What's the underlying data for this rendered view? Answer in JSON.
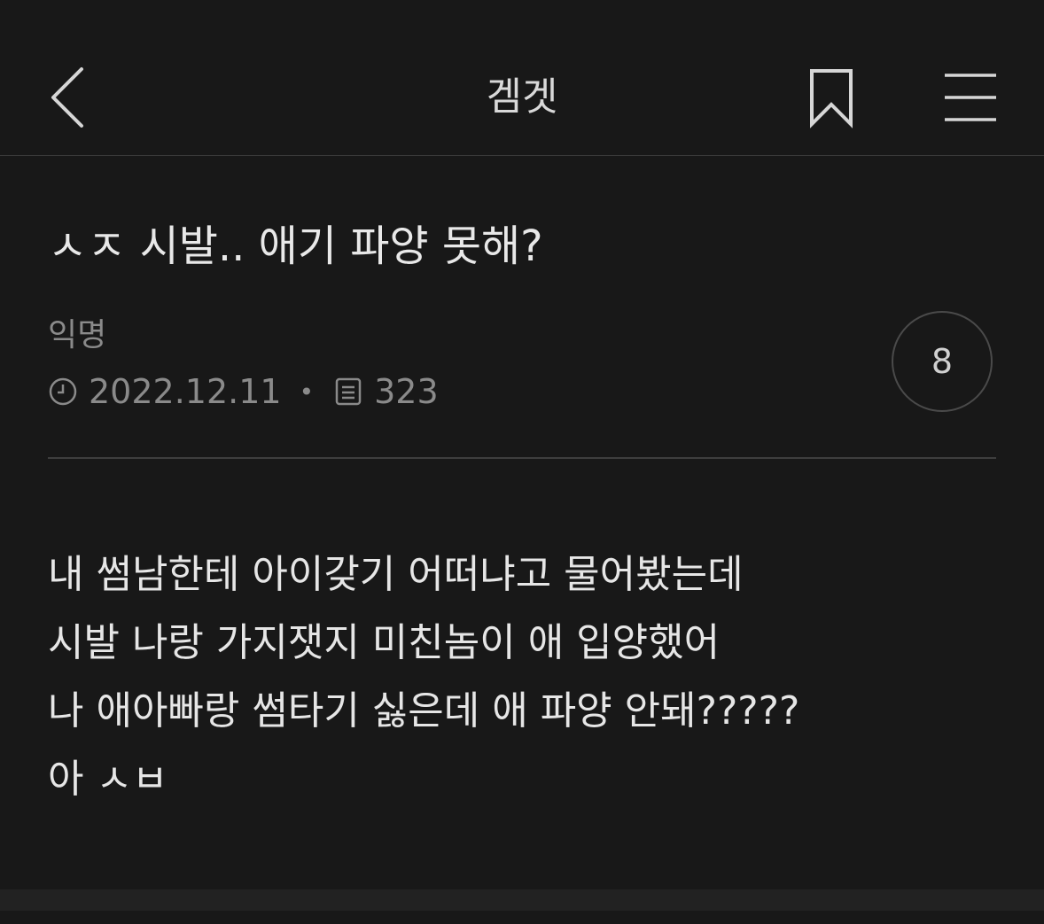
{
  "header": {
    "title": "겜겟",
    "back_icon": "chevron-left-icon",
    "bookmark_icon": "bookmark-icon",
    "menu_icon": "hamburger-menu-icon"
  },
  "post": {
    "title": "ㅅㅈ 시발.. 애기 파양 못해?",
    "author": "익명",
    "date": "2022.12.11",
    "views": "323",
    "comment_count": "8",
    "body_lines": [
      "내 썸남한테 아이갖기 어떠냐고 물어봤는데",
      "시발 나랑 가지잿지 미친놈이 애 입양했어",
      "나 애아빠랑 썸타기 싫은데 애 파양 안돼?????",
      "아 ㅅㅂ"
    ]
  },
  "colors": {
    "background": "#181818",
    "text": "#e6e6e6",
    "muted": "#8a8a8a",
    "divider": "#3e3e3e"
  }
}
